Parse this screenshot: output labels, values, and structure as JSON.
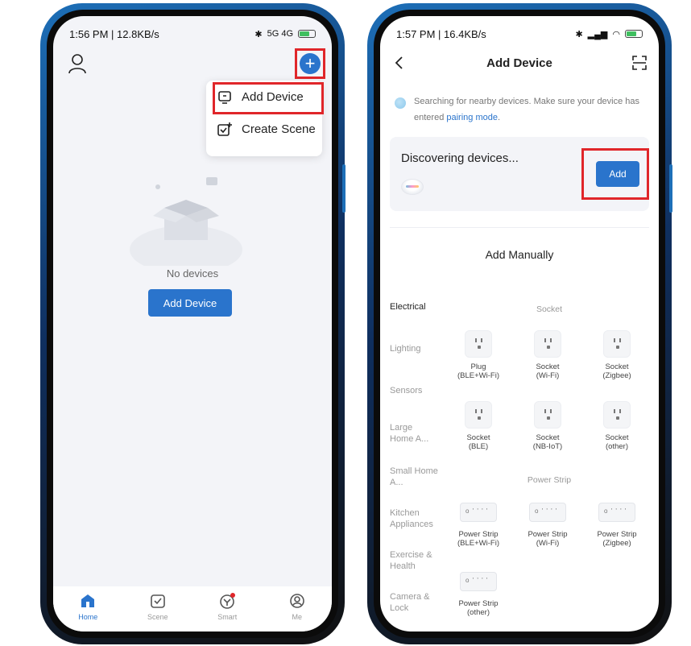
{
  "left": {
    "status": {
      "time_info": "1:56 PM | 12.8KB/s",
      "indicators": "5G 4G"
    },
    "menu": {
      "add_device": "Add Device",
      "create_scene": "Create Scene"
    },
    "empty": {
      "text": "No devices",
      "button": "Add Device"
    },
    "tabs": [
      {
        "label": "Home",
        "icon": "home-icon",
        "active": true
      },
      {
        "label": "Scene",
        "icon": "scene-icon",
        "active": false
      },
      {
        "label": "Smart",
        "icon": "smart-icon",
        "active": false
      },
      {
        "label": "Me",
        "icon": "me-icon",
        "active": false
      }
    ]
  },
  "right": {
    "status": {
      "time_info": "1:57 PM | 16.4KB/s"
    },
    "title": "Add Device",
    "search_text": "Searching for nearby devices. Make sure your device has entered ",
    "pairing_link": "pairing mode",
    "pairing_suffix": ".",
    "discovering": "Discovering devices...",
    "add_button": "Add",
    "manual_title": "Add Manually",
    "categories": [
      "Electrical",
      "Lighting",
      "Sensors",
      "Large Home A...",
      "Small Home A...",
      "Kitchen Appliances",
      "Exercise & Health",
      "Camera & Lock"
    ],
    "sections": {
      "socket": "Socket",
      "power_strip": "Power Strip"
    },
    "socket_devices": [
      [
        "Plug",
        "(BLE+Wi-Fi)"
      ],
      [
        "Socket",
        "(Wi-Fi)"
      ],
      [
        "Socket",
        "(Zigbee)"
      ],
      [
        "Socket",
        "(BLE)"
      ],
      [
        "Socket",
        "(NB-IoT)"
      ],
      [
        "Socket",
        "(other)"
      ]
    ],
    "strip_devices": [
      [
        "Power Strip",
        "(BLE+Wi-Fi)"
      ],
      [
        "Power Strip",
        "(Wi-Fi)"
      ],
      [
        "Power Strip",
        "(Zigbee)"
      ],
      [
        "Power Strip",
        "(other)"
      ]
    ]
  },
  "colors": {
    "accent": "#2a74cc",
    "highlight": "#e0262a",
    "frame": "#1d6fb8"
  }
}
